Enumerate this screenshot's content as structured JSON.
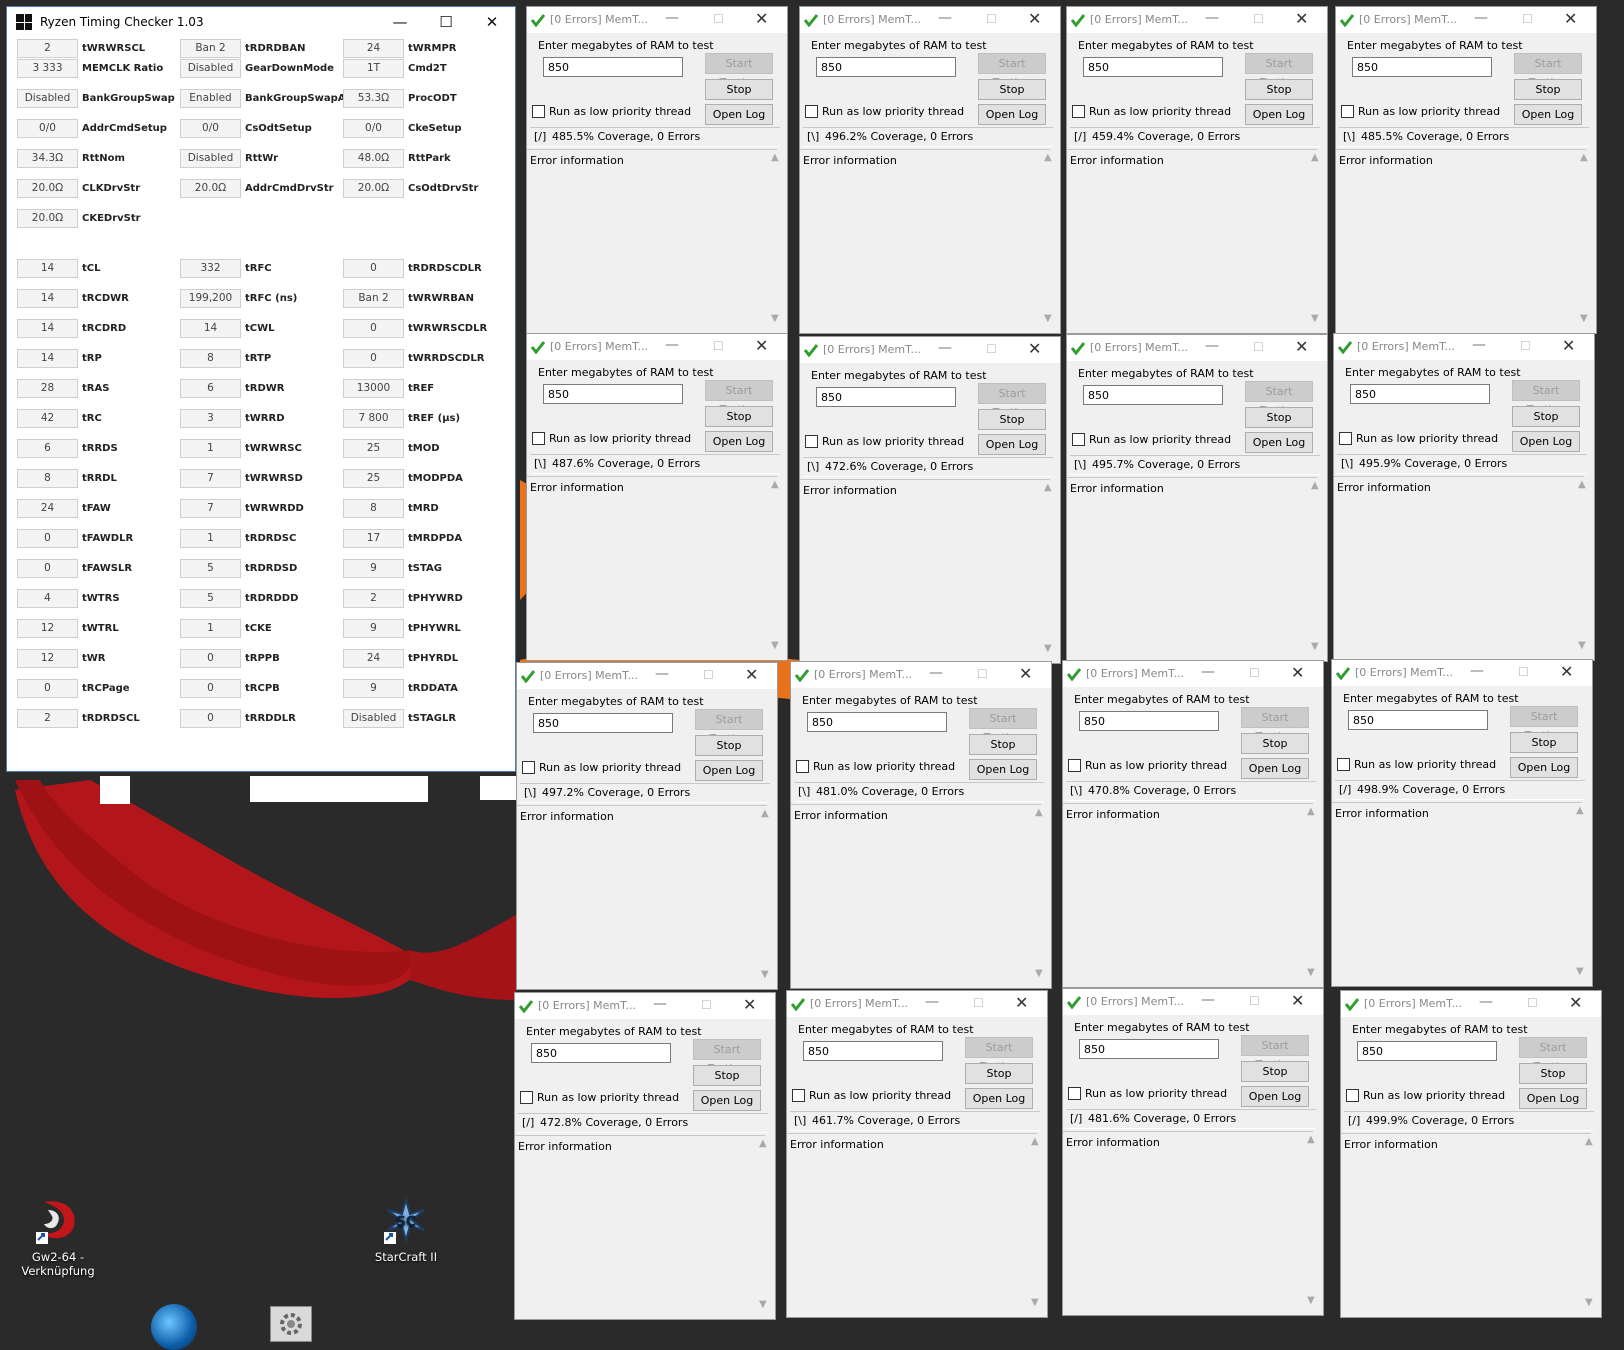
{
  "timing_checker": {
    "title": "Ryzen Timing Checker 1.03",
    "controls": {
      "minimize": "—",
      "maximize": "☐",
      "close": "✕"
    },
    "cells": [
      {
        "value": "3 333",
        "label": "MEMCLK Ratio"
      },
      {
        "value": "Disabled",
        "label": "GearDownMode"
      },
      {
        "value": "1T",
        "label": "Cmd2T"
      },
      {
        "value": "Disabled",
        "label": "BankGroupSwap"
      },
      {
        "value": "Enabled",
        "label": "BankGroupSwapAlt"
      },
      {
        "value": "53.3Ω",
        "label": "ProcODT"
      },
      {
        "value": "0/0",
        "label": "AddrCmdSetup"
      },
      {
        "value": "0/0",
        "label": "CsOdtSetup"
      },
      {
        "value": "0/0",
        "label": "CkeSetup"
      },
      {
        "value": "34.3Ω",
        "label": "RttNom"
      },
      {
        "value": "Disabled",
        "label": "RttWr"
      },
      {
        "value": "48.0Ω",
        "label": "RttPark"
      },
      {
        "value": "20.0Ω",
        "label": "CLKDrvStr"
      },
      {
        "value": "20.0Ω",
        "label": "AddrCmdDrvStr"
      },
      {
        "value": "20.0Ω",
        "label": "CsOdtDrvStr"
      },
      {
        "value": "20.0Ω",
        "label": "CKEDrvStr"
      },
      {
        "value": "14",
        "label": "tCL"
      },
      {
        "value": "332",
        "label": "tRFC"
      },
      {
        "value": "0",
        "label": "tRDRDSCDLR"
      },
      {
        "value": "14",
        "label": "tRCDWR"
      },
      {
        "value": "199,200",
        "label": "tRFC (ns)"
      },
      {
        "value": "Ban 2",
        "label": "tWRWRBAN"
      },
      {
        "value": "14",
        "label": "tRCDRD"
      },
      {
        "value": "14",
        "label": "tCWL"
      },
      {
        "value": "0",
        "label": "tWRWRSCDLR"
      },
      {
        "value": "14",
        "label": "tRP"
      },
      {
        "value": "8",
        "label": "tRTP"
      },
      {
        "value": "0",
        "label": "tWRRDSCDLR"
      },
      {
        "value": "28",
        "label": "tRAS"
      },
      {
        "value": "6",
        "label": "tRDWR"
      },
      {
        "value": "13000",
        "label": "tREF"
      },
      {
        "value": "42",
        "label": "tRC"
      },
      {
        "value": "3",
        "label": "tWRRD"
      },
      {
        "value": "7 800",
        "label": "tREF (µs)"
      },
      {
        "value": "6",
        "label": "tRRDS"
      },
      {
        "value": "1",
        "label": "tWRWRSC"
      },
      {
        "value": "25",
        "label": "tMOD"
      },
      {
        "value": "8",
        "label": "tRRDL"
      },
      {
        "value": "7",
        "label": "tWRWRSD"
      },
      {
        "value": "25",
        "label": "tMODPDA"
      },
      {
        "value": "24",
        "label": "tFAW"
      },
      {
        "value": "7",
        "label": "tWRWRDD"
      },
      {
        "value": "8",
        "label": "tMRD"
      },
      {
        "value": "0",
        "label": "tFAWDLR"
      },
      {
        "value": "1",
        "label": "tRDRDSC"
      },
      {
        "value": "17",
        "label": "tMRDPDA"
      },
      {
        "value": "0",
        "label": "tFAWSLR"
      },
      {
        "value": "5",
        "label": "tRDRDSD"
      },
      {
        "value": "9",
        "label": "tSTAG"
      },
      {
        "value": "4",
        "label": "tWTRS"
      },
      {
        "value": "5",
        "label": "tRDRDDD"
      },
      {
        "value": "2",
        "label": "tPHYWRD"
      },
      {
        "value": "12",
        "label": "tWTRL"
      },
      {
        "value": "1",
        "label": "tCKE"
      },
      {
        "value": "9",
        "label": "tPHYWRL"
      },
      {
        "value": "12",
        "label": "tWR"
      },
      {
        "value": "0",
        "label": "tRPPB"
      },
      {
        "value": "24",
        "label": "tPHYRDL"
      },
      {
        "value": "0",
        "label": "tRCPage"
      },
      {
        "value": "0",
        "label": "tRCPB"
      },
      {
        "value": "9",
        "label": "tRDDATA"
      },
      {
        "value": "2",
        "label": "tRDRDSCL"
      },
      {
        "value": "0",
        "label": "tRRDDLR"
      },
      {
        "value": "Disabled",
        "label": "tSTAGLR"
      },
      {
        "value": "2",
        "label": "tWRWRSCL"
      },
      {
        "value": "Ban 2",
        "label": "tRDRDBAN"
      },
      {
        "value": "24",
        "label": "tWRMPR"
      }
    ]
  },
  "memtest_common": {
    "title": "[0 Errors] MemT...",
    "prompt": "Enter megabytes of RAM to test",
    "ram_value": "850",
    "start_label": "Start Testing",
    "stop_label": "Stop Testing",
    "openlog_label": "Open Log",
    "low_priority_label": "Run as low priority thread",
    "error_info_label": "Error information",
    "min_glyph": "—",
    "max_glyph": "☐",
    "close_glyph": "✕",
    "scroll_up": "▲",
    "scroll_down": "▼"
  },
  "memtest_windows": [
    {
      "spinner": "[/]",
      "coverage": "485.5% Coverage, 0 Errors"
    },
    {
      "spinner": "[\\]",
      "coverage": "496.2% Coverage, 0 Errors"
    },
    {
      "spinner": "[/]",
      "coverage": "459.4% Coverage, 0 Errors"
    },
    {
      "spinner": "[\\]",
      "coverage": "485.5% Coverage, 0 Errors"
    },
    {
      "spinner": "[\\]",
      "coverage": "487.6% Coverage, 0 Errors"
    },
    {
      "spinner": "[\\]",
      "coverage": "472.6% Coverage, 0 Errors"
    },
    {
      "spinner": "[\\]",
      "coverage": "495.7% Coverage, 0 Errors"
    },
    {
      "spinner": "[\\]",
      "coverage": "495.9% Coverage, 0 Errors"
    },
    {
      "spinner": "[\\]",
      "coverage": "497.2% Coverage, 0 Errors"
    },
    {
      "spinner": "[\\]",
      "coverage": "481.0% Coverage, 0 Errors"
    },
    {
      "spinner": "[\\]",
      "coverage": "470.8% Coverage, 0 Errors"
    },
    {
      "spinner": "[/]",
      "coverage": "498.9% Coverage, 0 Errors"
    },
    {
      "spinner": "[/]",
      "coverage": "472.8% Coverage, 0 Errors"
    },
    {
      "spinner": "[\\]",
      "coverage": "461.7% Coverage, 0 Errors"
    },
    {
      "spinner": "[/]",
      "coverage": "481.6% Coverage, 0 Errors"
    },
    {
      "spinner": "[/]",
      "coverage": "499.9% Coverage, 0 Errors"
    }
  ],
  "desktop_icons": [
    {
      "label": "Gw2-64 - Verknüpfung",
      "icon": "guild-wars-2-icon"
    },
    {
      "label": "StarCraft II",
      "icon": "starcraft-2-icon"
    }
  ],
  "colors": {
    "wallpaper": "#2a2a2a",
    "swirl_red": "#b3161a",
    "swirl_orange": "#e9731c",
    "memtest_check": "#2f9e2f"
  }
}
